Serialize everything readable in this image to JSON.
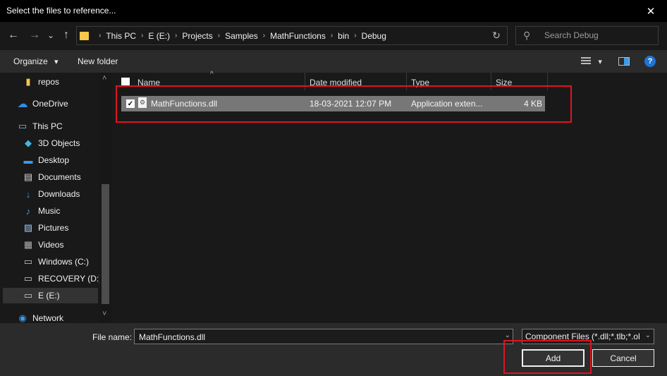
{
  "window": {
    "title": "Select the files to reference...",
    "close_glyph": "✕"
  },
  "nav": {
    "back_glyph": "←",
    "forward_glyph": "→",
    "recent_glyph": "⌄",
    "up_glyph": "↑",
    "breadcrumbs": [
      "This PC",
      "E (E:)",
      "Projects",
      "Samples",
      "MathFunctions",
      "bin",
      "Debug"
    ],
    "separator": "›",
    "refresh_glyph": "↻",
    "search_placeholder": "Search Debug",
    "search_glyph": "⚲"
  },
  "toolbar": {
    "organize_label": "Organize",
    "dropdown_glyph": "▾",
    "new_folder_label": "New folder",
    "help_glyph": "?"
  },
  "sidebar": {
    "items": [
      {
        "label": "repos",
        "icon": "folder-icon",
        "glyph": "▮",
        "color": "#f5c84c"
      },
      {
        "label": "OneDrive",
        "icon": "cloud-icon",
        "glyph": "☁",
        "color": "#2f8ee8"
      },
      {
        "label": "This PC",
        "icon": "computer-icon",
        "glyph": "▭",
        "color": "#7fb8e8"
      },
      {
        "label": "3D Objects",
        "icon": "cube-icon",
        "glyph": "◆",
        "color": "#3fb8e0"
      },
      {
        "label": "Desktop",
        "icon": "desktop-icon",
        "glyph": "▬",
        "color": "#3d9be9"
      },
      {
        "label": "Documents",
        "icon": "document-icon",
        "glyph": "▤",
        "color": "#d8d8d8"
      },
      {
        "label": "Downloads",
        "icon": "download-icon",
        "glyph": "↓",
        "color": "#3d9be9"
      },
      {
        "label": "Music",
        "icon": "music-icon",
        "glyph": "♪",
        "color": "#3d9be9"
      },
      {
        "label": "Pictures",
        "icon": "pictures-icon",
        "glyph": "▨",
        "color": "#9bc7ee"
      },
      {
        "label": "Videos",
        "icon": "video-icon",
        "glyph": "▦",
        "color": "#b0b0b0"
      },
      {
        "label": "Windows (C:)",
        "icon": "drive-icon",
        "glyph": "▭",
        "color": "#c8c8c8"
      },
      {
        "label": "RECOVERY (D:)",
        "icon": "drive-icon",
        "glyph": "▭",
        "color": "#c8c8c8"
      },
      {
        "label": "E (E:)",
        "icon": "drive-icon",
        "glyph": "▭",
        "color": "#c8c8c8"
      },
      {
        "label": "Network",
        "icon": "network-icon",
        "glyph": "◉",
        "color": "#3d9be9"
      }
    ],
    "scroll_up_glyph": "˄",
    "scroll_down_glyph": "˅"
  },
  "filelist": {
    "columns": [
      "Name",
      "Date modified",
      "Type",
      "Size"
    ],
    "sort_glyph": "^",
    "files": [
      {
        "name": "MathFunctions.dll",
        "date": "18-03-2021 12:07 PM",
        "type": "Application exten...",
        "size": "4 KB",
        "checked_glyph": "✓",
        "file_glyph": "⚙"
      }
    ]
  },
  "footer": {
    "filename_label": "File name:",
    "filename_value": "MathFunctions.dll",
    "dropdown_glyph": "⌄",
    "filetype_value": "Component Files (*.dll;*.tlb;*.ol",
    "add_label": "Add",
    "cancel_label": "Cancel"
  },
  "colors": {
    "highlight_box": "#e0141e",
    "accent": "#3d9be9",
    "selected_row": "#777777"
  }
}
